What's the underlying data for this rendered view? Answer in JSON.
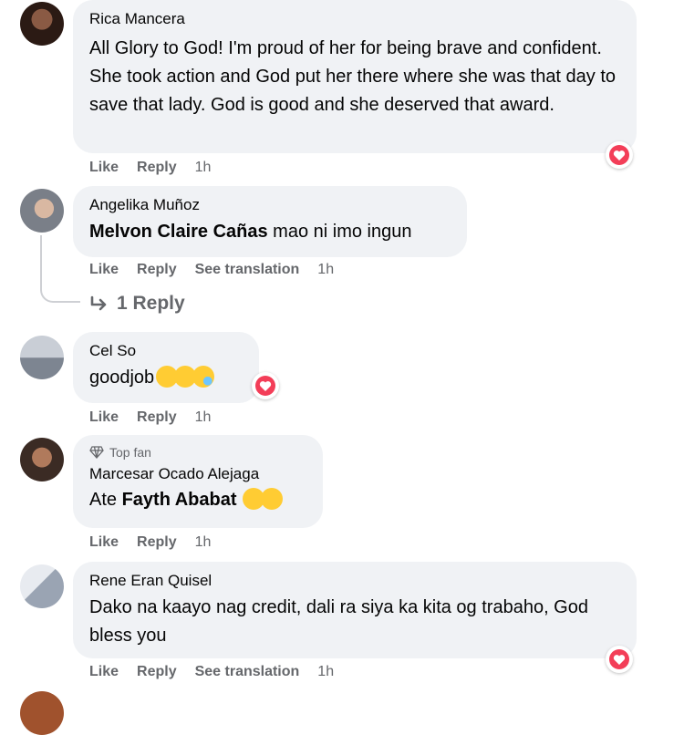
{
  "comments": [
    {
      "author": "Rica Mancera",
      "text": "All Glory to God! I'm proud of her for being brave and confident. She took action and God put her there where she was that day to save that lady. God is good and she deserved that award.",
      "actions": {
        "like": "Like",
        "reply": "Reply",
        "time": "1h"
      },
      "reaction": "heart"
    },
    {
      "author": "Angelika Muñoz",
      "mention": "Melvon Claire Cañas",
      "text": " mao ni imo ingun",
      "actions": {
        "like": "Like",
        "reply": "Reply",
        "see_translation": "See translation",
        "time": "1h"
      },
      "replies_link": "1 Reply"
    },
    {
      "author": "Cel So",
      "text": "goodjob",
      "emojis": [
        "clapping-hands",
        "clapping-hands",
        "crying-face"
      ],
      "actions": {
        "like": "Like",
        "reply": "Reply",
        "time": "1h"
      },
      "reaction": "heart"
    },
    {
      "badge": "Top fan",
      "author": "Marcesar Ocado Alejaga",
      "prefix": "Ate ",
      "mention": "Fayth Ababat",
      "emojis": [
        "pleading-face",
        "clapping-hands"
      ],
      "actions": {
        "like": "Like",
        "reply": "Reply",
        "time": "1h"
      }
    },
    {
      "author": "Rene Eran Quisel",
      "text": "Dako na kaayo nag credit, dali ra siya ka kita og trabaho, God bless you",
      "actions": {
        "like": "Like",
        "reply": "Reply",
        "see_translation": "See translation",
        "time": "1h"
      },
      "reaction": "heart"
    }
  ],
  "colors": {
    "bubble": "#f0f2f5",
    "meta": "#65676b",
    "heart": "#f33e58",
    "text": "#050505"
  }
}
